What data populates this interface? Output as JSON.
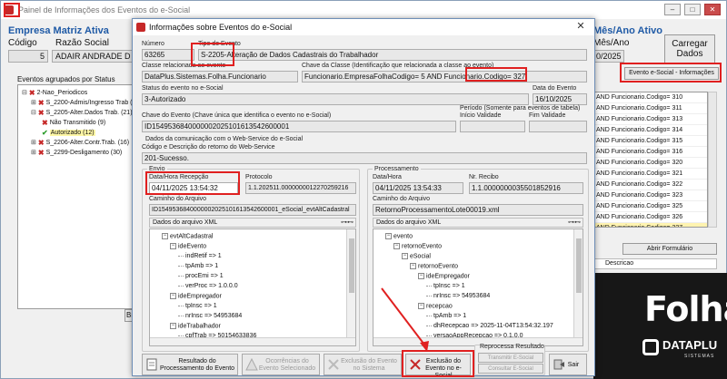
{
  "main": {
    "title": "Painel de Informações dos Eventos do e-Social",
    "company": "Empresa Matriz Ativa",
    "codigo_label": "Código",
    "razao_label": "Razão Social",
    "codigo_value": "5",
    "razao_value": "ADAIR ANDRADE D",
    "grupo_label": "Eventos agrupados por Status",
    "tree": [
      {
        "text": "2-Nao_Periodicos",
        "icon": "x",
        "exp": "⊟"
      },
      {
        "text": "S_2200-Admis/Ingresso Trab (15)",
        "icon": "x",
        "exp": "⊞"
      },
      {
        "text": "S_2205-Alter.Dados Trab. (21)",
        "icon": "x",
        "exp": "⊟"
      },
      {
        "text": "Não Transmitido (9)",
        "icon": "x",
        "exp": ""
      },
      {
        "text": "Autorizado (12)",
        "icon": "check",
        "exp": ""
      },
      {
        "text": "S_2206-Alter.Contr.Trab. (16)",
        "icon": "x",
        "exp": "⊞"
      },
      {
        "text": "S_2299-Desligamento (30)",
        "icon": "x",
        "exp": "⊞"
      }
    ],
    "mes_label": "Mês/Ano Ativo",
    "mes_ano_label": "Mês/Ano",
    "mes_ano_value": "0/2025",
    "carregar_label": "Carregar Dados",
    "esocial_info_label": "Evento e-Social - Informações",
    "right_list": [
      "AND Funcionario.Codigo= 310",
      "AND Funcionario.Codigo= 311",
      "AND Funcionario.Codigo= 313",
      "AND Funcionario.Codigo= 314",
      "AND Funcionario.Codigo= 315",
      "AND Funcionario.Codigo= 316",
      "AND Funcionario.Codigo= 320",
      "AND Funcionario.Codigo= 321",
      "AND Funcionario.Codigo= 322",
      "AND Funcionario.Codigo= 323",
      "AND Funcionario.Codigo= 325",
      "AND Funcionario.Codigo= 326",
      "AND Funcionario.Codigo= 327"
    ],
    "abrir_label": "Abrir Formulário",
    "descricao_label": "Descricao",
    "brand_folha": "Folha",
    "brand_datapu": "DATAPLU",
    "brand_sistemas": "SISTEMAS",
    "bottom_left_btn": "Br"
  },
  "dialog": {
    "title": "Informações sobre Eventos do e-Social",
    "close": "✕",
    "numero_label": "Número",
    "numero_value": "63265",
    "tipo_label": "Tipo do Evento",
    "tipo_value": "S-2205-Alteração de Dados Cadastrais do Trabalhador",
    "classe_label": "Classe relacionada ao evento",
    "classe_value": "DataPlus.Sistemas.Folha.Funcionario",
    "chave_classe_label": "Chave da Classe (Identificação que relacionada a classe ao evento)",
    "chave_classe_value": "Funcionario.EmpresaFolhaCodigo= 5  AND Funcionario.Codigo= 327",
    "status_label": "Status do evento no e-Social",
    "status_value": "3-Autorizado",
    "data_evento_label": "Data do Evento",
    "data_evento_value": "16/10/2025",
    "chave_evento_label": "Chave do Evento (Chave única que identifica o evento no e-Social)",
    "chave_evento_value": "ID1549536840000002025101613542600001",
    "periodo_label": "Período (Somente para eventos de tabela)",
    "inicio_label": "Início Validade",
    "fim_label": "Fim Validade",
    "dados_com_label": "Dados da comunicação com o Web-Service do e-Social",
    "codigo_retorno_label": "Código e Descrição do retorno do Web-Service",
    "codigo_retorno_value": "201-Sucesso.",
    "envio": {
      "group_label": "Envio",
      "data_label": "Data/Hora Recepção",
      "data_value": "04/11/2025 13:54:32",
      "protocolo_label": "Protocolo",
      "protocolo_value": "1.1.202511.0000000012270259216",
      "caminho_label": "Caminho do Arquivo",
      "caminho_value": "ID1549536840000002025101613542600001_eSocial_evtAltCadastral",
      "xml_label": "Dados do arquivo XML",
      "xml_nodes": [
        {
          "text": "evtAltCadastral",
          "indent": 1,
          "box": "⊟"
        },
        {
          "text": "ideEvento",
          "indent": 2,
          "box": "⊟"
        },
        {
          "text": "indRetif => 1",
          "indent": 3,
          "box": ""
        },
        {
          "text": "tpAmb => 1",
          "indent": 3,
          "box": ""
        },
        {
          "text": "procEmi => 1",
          "indent": 3,
          "box": ""
        },
        {
          "text": "verProc => 1.0.0.0",
          "indent": 3,
          "box": ""
        },
        {
          "text": "ideEmpregador",
          "indent": 2,
          "box": "⊟"
        },
        {
          "text": "tpInsc => 1",
          "indent": 3,
          "box": ""
        },
        {
          "text": "nrInsc => 54953684",
          "indent": 3,
          "box": ""
        },
        {
          "text": "ideTrabalhador",
          "indent": 2,
          "box": "⊟"
        },
        {
          "text": "cpfTrab => 50154633836",
          "indent": 3,
          "box": ""
        }
      ]
    },
    "processamento": {
      "group_label": "Processamento",
      "data_label": "Data/Hora",
      "data_value": "04/11/2025 13:54:33",
      "recibo_label": "Nr. Recibo",
      "recibo_value": "1.1.0000000035501852916",
      "caminho_label": "Caminho do Arquivo",
      "caminho_value": "RetornoProcessamentoLote00019.xml",
      "xml_label": "Dados do arquivo XML",
      "xml_nodes": [
        {
          "text": "evento",
          "indent": 1,
          "box": "⊟"
        },
        {
          "text": "retornoEvento",
          "indent": 2,
          "box": "⊟"
        },
        {
          "text": "eSocial",
          "indent": 3,
          "box": "⊟"
        },
        {
          "text": "retornoEvento",
          "indent": 4,
          "box": "⊟"
        },
        {
          "text": "ideEmpregador",
          "indent": 5,
          "box": "⊟"
        },
        {
          "text": "tpInsc => 1",
          "indent": 6,
          "box": ""
        },
        {
          "text": "nrInsc => 54953684",
          "indent": 6,
          "box": ""
        },
        {
          "text": "recepcao",
          "indent": 5,
          "box": "⊟"
        },
        {
          "text": "tpAmb => 1",
          "indent": 6,
          "box": ""
        },
        {
          "text": "dhRecepcao => 2025-11-04T13:54:32.197",
          "indent": 6,
          "box": ""
        },
        {
          "text": "versaoAppRecepcao => 0.1.0.0",
          "indent": 6,
          "box": ""
        }
      ]
    },
    "buttons": {
      "resultado": "Resultado do Processamento do Evento",
      "ocorrencias": "Ocorrências do Evento Selecionado",
      "exclusao_sistema": "Exclusão do Evento no Sistema",
      "exclusao_esocial": "Exclusão do Evento no e-Social",
      "reprocessa_label": "Reprocessa Resultado",
      "transmitir": "Transmitir E-Social",
      "consultar": "Consultar E-Social",
      "sair": "Sair"
    }
  },
  "colors": {
    "highlight_red": "#e02020",
    "brand_blue": "#1f5aa6",
    "selected_yellow": "#fff7a6"
  }
}
